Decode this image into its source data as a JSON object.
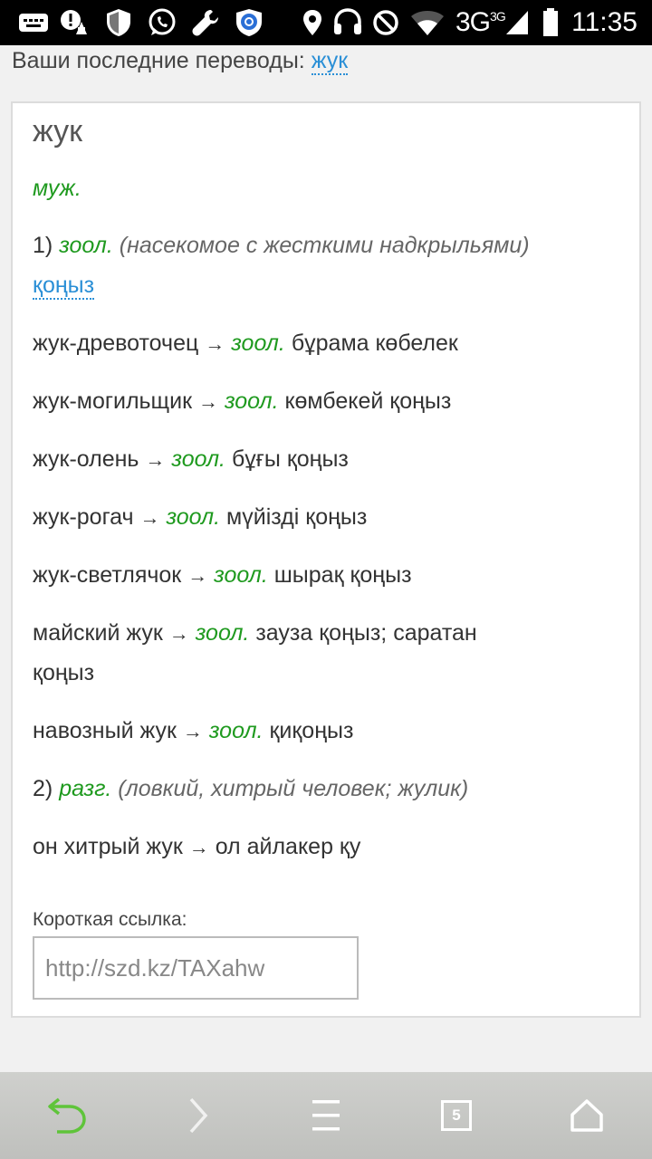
{
  "status_bar": {
    "time": "11:35",
    "network": "3G",
    "network_sup": "3G",
    "icons": [
      "keyboard-icon",
      "alert-icon",
      "shield-icon",
      "whatsapp-icon",
      "wrench-icon",
      "app-shield-icon",
      "location-icon",
      "headset-icon",
      "block-icon",
      "wifi-icon",
      "signal-icon",
      "battery-icon"
    ]
  },
  "recent": {
    "label": "Ваши последние переводы:",
    "link": "жук"
  },
  "entry": {
    "headword": "жук",
    "gender": "муж.",
    "sense1": {
      "num": "1)",
      "domain": "зоол.",
      "gloss": "(насекомое с жесткими надкрыльями)",
      "translation": "қоңыз"
    },
    "phrases": [
      {
        "src": "жук-древоточец",
        "arrow": "→",
        "domain": "зоол.",
        "tr": "бұрама көбелек"
      },
      {
        "src": "жук-могильщик",
        "arrow": "→",
        "domain": "зоол.",
        "tr": "көмбекей қоңыз"
      },
      {
        "src": "жук-олень",
        "arrow": "→",
        "domain": "зоол.",
        "tr": "бұғы қоңыз"
      },
      {
        "src": "жук-рогач",
        "arrow": "→",
        "domain": "зоол.",
        "tr": "мүйізді қоңыз"
      },
      {
        "src": "жук-светлячок",
        "arrow": "→",
        "domain": "зоол.",
        "tr": "шырақ қоңыз"
      },
      {
        "src": "майский жук",
        "arrow": "→",
        "domain": "зоол.",
        "tr": "зауза қоңыз; саратан",
        "tr2": "қоңыз"
      },
      {
        "src": "навозный жук",
        "arrow": "→",
        "domain": "зоол.",
        "tr": "қиқоңыз"
      }
    ],
    "sense2": {
      "num": "2)",
      "domain": "разг.",
      "gloss": "(ловкий, хитрый человек; жулик)"
    },
    "phrase2": {
      "src": "он хитрый жук",
      "arrow": "→",
      "tr": "ол айлакер қу"
    }
  },
  "short_link": {
    "label": "Короткая ссылка:",
    "value": "http://szd.kz/TAXahw"
  },
  "nav": {
    "tabs_count": "5",
    "colors": {
      "back": "#5fc43a",
      "forward": "#9a9a9a",
      "icon": "#ffffff"
    }
  }
}
